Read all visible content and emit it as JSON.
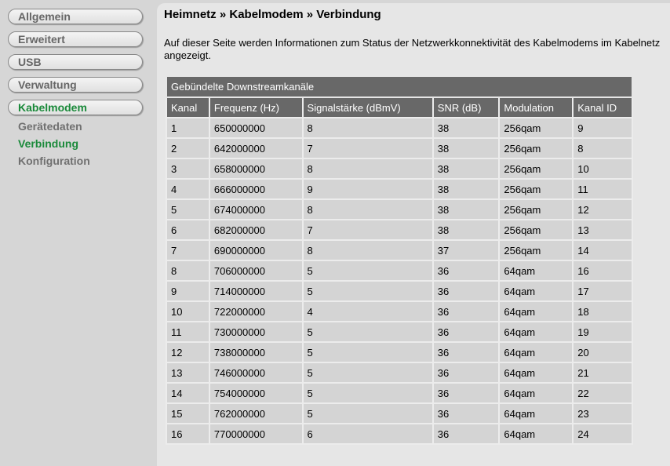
{
  "sidebar": {
    "items": [
      {
        "label": "Allgemein"
      },
      {
        "label": "Erweitert"
      },
      {
        "label": "USB"
      },
      {
        "label": "Verwaltung"
      },
      {
        "label": "Kabelmodem"
      }
    ],
    "subitems": [
      {
        "label": "Gerätedaten"
      },
      {
        "label": "Verbindung"
      },
      {
        "label": "Konfiguration"
      }
    ]
  },
  "main": {
    "title": "Heimnetz » Kabelmodem » Verbindung",
    "description": "Auf dieser Seite werden Informationen zum Status der Netzwerkkonnektivität des Kabelmodems im Kabelnetz angezeigt.",
    "table": {
      "caption": "Gebündelte Downstreamkanäle",
      "columns": [
        "Kanal",
        "Frequenz (Hz)",
        "Signalstärke (dBmV)",
        "SNR (dB)",
        "Modulation",
        "Kanal ID"
      ],
      "rows": [
        [
          "1",
          "650000000",
          "8",
          "38",
          "256qam",
          "9"
        ],
        [
          "2",
          "642000000",
          "7",
          "38",
          "256qam",
          "8"
        ],
        [
          "3",
          "658000000",
          "8",
          "38",
          "256qam",
          "10"
        ],
        [
          "4",
          "666000000",
          "9",
          "38",
          "256qam",
          "11"
        ],
        [
          "5",
          "674000000",
          "8",
          "38",
          "256qam",
          "12"
        ],
        [
          "6",
          "682000000",
          "7",
          "38",
          "256qam",
          "13"
        ],
        [
          "7",
          "690000000",
          "8",
          "37",
          "256qam",
          "14"
        ],
        [
          "8",
          "706000000",
          "5",
          "36",
          "64qam",
          "16"
        ],
        [
          "9",
          "714000000",
          "5",
          "36",
          "64qam",
          "17"
        ],
        [
          "10",
          "722000000",
          "4",
          "36",
          "64qam",
          "18"
        ],
        [
          "11",
          "730000000",
          "5",
          "36",
          "64qam",
          "19"
        ],
        [
          "12",
          "738000000",
          "5",
          "36",
          "64qam",
          "20"
        ],
        [
          "13",
          "746000000",
          "5",
          "36",
          "64qam",
          "21"
        ],
        [
          "14",
          "754000000",
          "5",
          "36",
          "64qam",
          "22"
        ],
        [
          "15",
          "762000000",
          "5",
          "36",
          "64qam",
          "23"
        ],
        [
          "16",
          "770000000",
          "6",
          "36",
          "64qam",
          "24"
        ]
      ]
    }
  }
}
